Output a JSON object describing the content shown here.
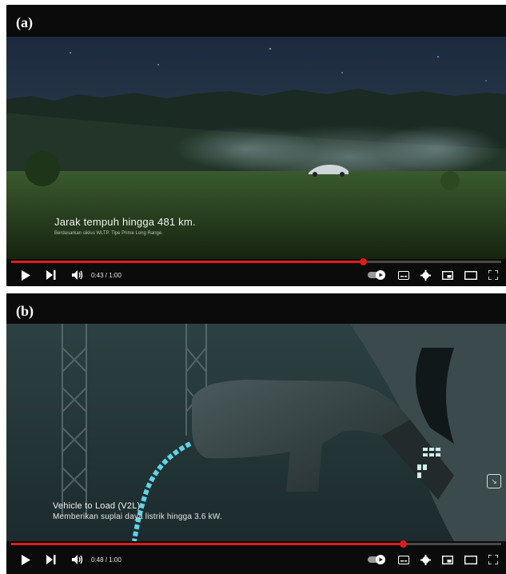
{
  "panels": [
    {
      "label": "(a)",
      "caption": "Jarak tempuh hingga 481 km.",
      "subcaption": "Berdasarkan siklus WLTP. Tipe Prime Long Range.",
      "time": "0:43 / 1:00",
      "progress": 0.717
    },
    {
      "label": "(b)",
      "caption": "Vehicle to Load (V2L)",
      "subcaption": "Memberikan suplai daya listrik hingga 3.6 kW.",
      "time": "0:48 / 1:00",
      "progress": 0.8
    }
  ],
  "colors": {
    "progress": "#e11b1b"
  },
  "icons": [
    "play-icon",
    "skip-next-icon",
    "volume-icon",
    "autoplay-toggle-icon",
    "subtitles-icon",
    "settings-gear-icon",
    "miniplayer-icon",
    "theater-mode-icon",
    "fullscreen-icon"
  ]
}
